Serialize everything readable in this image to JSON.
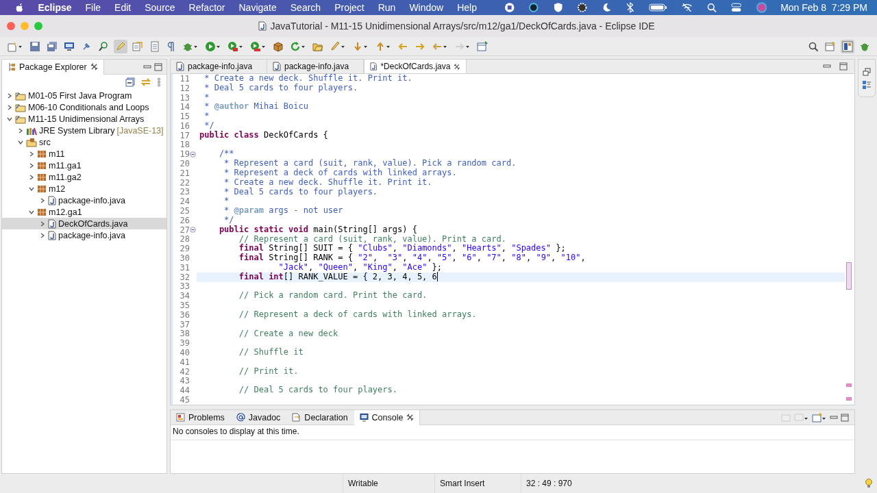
{
  "menu_bar": {
    "app": "Eclipse",
    "items": [
      "File",
      "Edit",
      "Source",
      "Refactor",
      "Navigate",
      "Search",
      "Project",
      "Run",
      "Window",
      "Help"
    ],
    "clock": "Mon Feb 8  7:29 PM"
  },
  "window": {
    "title": "JavaTutorial - M11-15 Unidimensional Arrays/src/m12/ga1/DeckOfCards.java - Eclipse IDE"
  },
  "package_explorer": {
    "title": "Package Explorer",
    "tree": [
      {
        "kind": "project",
        "label": "M01-05 First Java Program",
        "expanded": false,
        "selected": false
      },
      {
        "kind": "project",
        "label": "M06-10 Conditionals and Loops",
        "expanded": false,
        "selected": false
      },
      {
        "kind": "project",
        "label": "M11-15 Unidimensional Arrays",
        "expanded": true,
        "selected": false,
        "children": [
          {
            "kind": "library",
            "label": "JRE System Library",
            "decoration": "[JavaSE-13]",
            "expanded": false,
            "selected": false
          },
          {
            "kind": "folder",
            "label": "src",
            "expanded": true,
            "selected": false,
            "children": [
              {
                "kind": "package",
                "label": "m11",
                "expanded": false,
                "selected": false
              },
              {
                "kind": "package",
                "label": "m11.ga1",
                "expanded": false,
                "selected": false
              },
              {
                "kind": "package",
                "label": "m11.ga2",
                "expanded": false,
                "selected": false
              },
              {
                "kind": "package",
                "label": "m12",
                "expanded": true,
                "selected": false,
                "children": [
                  {
                    "kind": "file",
                    "label": "package-info.java",
                    "expanded": false,
                    "selected": false
                  }
                ]
              },
              {
                "kind": "package",
                "label": "m12.ga1",
                "expanded": true,
                "selected": false,
                "children": [
                  {
                    "kind": "file",
                    "label": "DeckOfCards.java",
                    "expanded": false,
                    "selected": true
                  },
                  {
                    "kind": "file",
                    "label": "package-info.java",
                    "expanded": false,
                    "selected": false
                  }
                ]
              }
            ]
          }
        ]
      }
    ]
  },
  "editor": {
    "tabs": [
      {
        "label": "package-info.java",
        "selected": false
      },
      {
        "label": "package-info.java",
        "selected": false
      },
      {
        "label": "*DeckOfCards.java",
        "selected": true
      }
    ],
    "lines": [
      {
        "number": "11",
        "tokens": [
          {
            "kind": "doc",
            "text": " * Create a new deck. Shuffle it. Print it."
          }
        ]
      },
      {
        "number": "12",
        "tokens": [
          {
            "kind": "doc",
            "text": " * Deal 5 cards to four players."
          }
        ]
      },
      {
        "number": "13",
        "tokens": [
          {
            "kind": "doc",
            "text": " *"
          }
        ]
      },
      {
        "number": "14",
        "tokens": [
          {
            "kind": "doc",
            "text": " * "
          },
          {
            "kind": "tag",
            "text": "@author"
          },
          {
            "kind": "doc",
            "text": " Mihai Boicu"
          }
        ]
      },
      {
        "number": "15",
        "tokens": [
          {
            "kind": "doc",
            "text": " *"
          }
        ]
      },
      {
        "number": "16",
        "tokens": [
          {
            "kind": "doc",
            "text": " */"
          }
        ]
      },
      {
        "number": "17",
        "tokens": [
          {
            "kind": "keyword",
            "text": "public "
          },
          {
            "kind": "keyword",
            "text": "class"
          },
          {
            "kind": "plain",
            "text": " DeckOfCards {"
          }
        ]
      },
      {
        "number": "18"
      },
      {
        "number": "19",
        "fold": true,
        "expanded": true,
        "tokens": [
          {
            "kind": "doc",
            "text": "    /**"
          }
        ]
      },
      {
        "number": "20",
        "tokens": [
          {
            "kind": "doc",
            "text": "     * Represent a card (suit, rank, value). Pick a random card."
          }
        ]
      },
      {
        "number": "21",
        "tokens": [
          {
            "kind": "doc",
            "text": "     * Represent a deck of cards with linked arrays."
          }
        ]
      },
      {
        "number": "22",
        "tokens": [
          {
            "kind": "doc",
            "text": "     * Create a new deck. Shuffle it. Print it."
          }
        ]
      },
      {
        "number": "23",
        "tokens": [
          {
            "kind": "doc",
            "text": "     * Deal 5 cards to four players."
          }
        ]
      },
      {
        "number": "24",
        "tokens": [
          {
            "kind": "doc",
            "text": "     *"
          }
        ]
      },
      {
        "number": "25",
        "tokens": [
          {
            "kind": "doc",
            "text": "     * "
          },
          {
            "kind": "tag",
            "text": "@param"
          },
          {
            "kind": "doc",
            "text": " args - not user"
          }
        ]
      },
      {
        "number": "26",
        "tokens": [
          {
            "kind": "doc",
            "text": "     */"
          }
        ]
      },
      {
        "number": "27",
        "fold": true,
        "expanded": true,
        "tokens": [
          {
            "kind": "keyword",
            "text": "    public static void"
          },
          {
            "kind": "plain",
            "text": " main(String[] args) {"
          }
        ]
      },
      {
        "number": "28",
        "tokens": [
          {
            "kind": "comment",
            "text": "        // Represent a card (suit, rank, value). Print a card."
          }
        ]
      },
      {
        "number": "29",
        "tokens": [
          {
            "kind": "keyword",
            "text": "        final"
          },
          {
            "kind": "plain",
            "text": " String[] SUIT = { "
          },
          {
            "kind": "string",
            "text": "\"Clubs\""
          },
          {
            "kind": "plain",
            "text": ", "
          },
          {
            "kind": "string",
            "text": "\"Diamonds\""
          },
          {
            "kind": "plain",
            "text": ", "
          },
          {
            "kind": "string",
            "text": "\"Hearts\""
          },
          {
            "kind": "plain",
            "text": ", "
          },
          {
            "kind": "string",
            "text": "\"Spades\""
          },
          {
            "kind": "plain",
            "text": " };"
          }
        ]
      },
      {
        "number": "30",
        "tokens": [
          {
            "kind": "keyword",
            "text": "        final"
          },
          {
            "kind": "plain",
            "text": " String[] RANK = { "
          },
          {
            "kind": "string",
            "text": "\"2\""
          },
          {
            "kind": "plain",
            "text": ",  "
          },
          {
            "kind": "string",
            "text": "\"3\""
          },
          {
            "kind": "plain",
            "text": ", "
          },
          {
            "kind": "string",
            "text": "\"4\""
          },
          {
            "kind": "plain",
            "text": ", "
          },
          {
            "kind": "string",
            "text": "\"5\""
          },
          {
            "kind": "plain",
            "text": ", "
          },
          {
            "kind": "string",
            "text": "\"6\""
          },
          {
            "kind": "plain",
            "text": ", "
          },
          {
            "kind": "string",
            "text": "\"7\""
          },
          {
            "kind": "plain",
            "text": ", "
          },
          {
            "kind": "string",
            "text": "\"8\""
          },
          {
            "kind": "plain",
            "text": ", "
          },
          {
            "kind": "string",
            "text": "\"9\""
          },
          {
            "kind": "plain",
            "text": ", "
          },
          {
            "kind": "string",
            "text": "\"10\""
          },
          {
            "kind": "plain",
            "text": ","
          }
        ]
      },
      {
        "number": "31",
        "tokens": [
          {
            "kind": "string",
            "text": "                \"Jack\""
          },
          {
            "kind": "plain",
            "text": ", "
          },
          {
            "kind": "string",
            "text": "\"Queen\""
          },
          {
            "kind": "plain",
            "text": ", "
          },
          {
            "kind": "string",
            "text": "\"King\""
          },
          {
            "kind": "plain",
            "text": ", "
          },
          {
            "kind": "string",
            "text": "\"Ace\""
          },
          {
            "kind": "plain",
            "text": " };"
          }
        ]
      },
      {
        "number": "32",
        "current": true,
        "tokens": [
          {
            "kind": "keyword",
            "text": "        final int"
          },
          {
            "kind": "plain",
            "text": "[] RANK_VALUE = { 2, 3, 4, 5, 6"
          }
        ]
      },
      {
        "number": "33"
      },
      {
        "number": "34",
        "tokens": [
          {
            "kind": "comment",
            "text": "        // Pick a random card. Print the card."
          }
        ]
      },
      {
        "number": "35"
      },
      {
        "number": "36",
        "tokens": [
          {
            "kind": "comment",
            "text": "        // Represent a deck of cards with linked arrays."
          }
        ]
      },
      {
        "number": "37"
      },
      {
        "number": "38",
        "tokens": [
          {
            "kind": "comment",
            "text": "        // Create a new deck"
          }
        ]
      },
      {
        "number": "39"
      },
      {
        "number": "40",
        "tokens": [
          {
            "kind": "comment",
            "text": "        // Shuffle it"
          }
        ]
      },
      {
        "number": "41"
      },
      {
        "number": "42",
        "tokens": [
          {
            "kind": "comment",
            "text": "        // Print it."
          }
        ]
      },
      {
        "number": "43"
      },
      {
        "number": "44",
        "tokens": [
          {
            "kind": "comment",
            "text": "        // Deal 5 cards to four players."
          }
        ]
      },
      {
        "number": "45"
      }
    ]
  },
  "bottom_panel": {
    "tabs": [
      {
        "kind": "problems",
        "label": "Problems",
        "selected": false
      },
      {
        "kind": "javadoc",
        "label": "Javadoc",
        "selected": false
      },
      {
        "kind": "declaration",
        "label": "Declaration",
        "selected": false
      },
      {
        "kind": "console",
        "label": "Console",
        "selected": true
      }
    ],
    "message": "No consoles to display at this time."
  },
  "status_bar": {
    "fields": [
      "Writable",
      "Smart Insert",
      "32 : 49 : 970"
    ]
  }
}
